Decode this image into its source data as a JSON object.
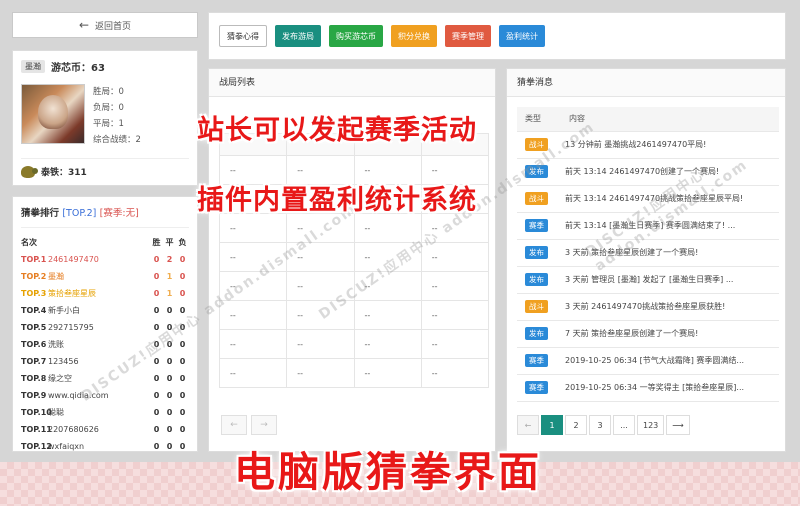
{
  "nav": {
    "back_label": "返回首页"
  },
  "profile": {
    "username_tag": "墨瀚",
    "coins_label": "游芯币：63",
    "stats": [
      "胜局：0",
      "负局：0",
      "平局：1",
      "综合战绩：2"
    ],
    "copper_label": "泰铁：311"
  },
  "ranking": {
    "title": "猜拳排行",
    "top_tag": "[TOP.2]",
    "season_tag": "[赛季:无]",
    "headers": {
      "name": "名次",
      "win": "胜",
      "draw": "平",
      "lose": "负"
    },
    "rows": [
      {
        "pos": "TOP.1",
        "name": "2461497470",
        "w": "0",
        "d": "2",
        "l": "0"
      },
      {
        "pos": "TOP.2",
        "name": "墨瀚",
        "w": "0",
        "d": "1",
        "l": "0"
      },
      {
        "pos": "TOP.3",
        "name": "策拾叁座星辰",
        "w": "0",
        "d": "1",
        "l": "0"
      },
      {
        "pos": "TOP.4",
        "name": "新手小白",
        "w": "0",
        "d": "0",
        "l": "0"
      },
      {
        "pos": "TOP.5",
        "name": "292715795",
        "w": "0",
        "d": "0",
        "l": "0"
      },
      {
        "pos": "TOP.6",
        "name": "洗账",
        "w": "0",
        "d": "0",
        "l": "0"
      },
      {
        "pos": "TOP.7",
        "name": "123456",
        "w": "0",
        "d": "0",
        "l": "0"
      },
      {
        "pos": "TOP.8",
        "name": "缘之空",
        "w": "0",
        "d": "0",
        "l": "0"
      },
      {
        "pos": "TOP.9",
        "name": "www.qidia.com",
        "w": "0",
        "d": "0",
        "l": "0"
      },
      {
        "pos": "TOP.10",
        "name": "聪聪",
        "w": "0",
        "d": "0",
        "l": "0"
      },
      {
        "pos": "TOP.11",
        "name": "2207680626",
        "w": "0",
        "d": "0",
        "l": "0"
      },
      {
        "pos": "TOP.12",
        "name": "wxfaiqxn",
        "w": "0",
        "d": "0",
        "l": "0"
      }
    ]
  },
  "toolbar": {
    "buttons": [
      "猜拳心得",
      "发布游局",
      "购买游芯币",
      "积分兑换",
      "赛季管理",
      "盈利统计"
    ]
  },
  "battle_list": {
    "title": "战局列表",
    "placeholder": "--",
    "pager": [
      "←",
      "→"
    ]
  },
  "messages": {
    "title": "猜拳消息",
    "col_type": "类型",
    "col_content": "内容",
    "rows": [
      {
        "type": "战斗",
        "color": "orange",
        "text": "13 分钟前 墨瀚挑战2461497470平局!"
      },
      {
        "type": "发布",
        "color": "blue",
        "text": "前天 13:14 2461497470创建了一个赛局!"
      },
      {
        "type": "战斗",
        "color": "orange",
        "text": "前天 13:14 2461497470挑战策拾叁座星辰平局!"
      },
      {
        "type": "赛季",
        "color": "blue",
        "text": "前天 13:14 [墨瀚生日赛季] 赛季圆满结束了! ..."
      },
      {
        "type": "发布",
        "color": "blue",
        "text": "3 天前 策拾叁座星辰创建了一个赛局!"
      },
      {
        "type": "发布",
        "color": "blue",
        "text": "3 天前 管理员 [墨瀚] 发起了 [墨瀚生日赛季] ..."
      },
      {
        "type": "战斗",
        "color": "orange",
        "text": "3 天前 2461497470挑战策拾叁座星辰获胜!"
      },
      {
        "type": "发布",
        "color": "blue",
        "text": "7 天前 策拾叁座星辰创建了一个赛局!"
      },
      {
        "type": "赛季",
        "color": "blue",
        "text": "2019-10-25 06:34 [节气大战霜降] 赛季圆满结..."
      },
      {
        "type": "赛季",
        "color": "blue",
        "text": "2019-10-25 06:34 一等奖得主 [策拾叁座星辰]..."
      }
    ],
    "pager": [
      "←",
      "1",
      "2",
      "3",
      "...",
      "123",
      "⟶"
    ]
  },
  "overlay": {
    "line1": "站长可以发起赛季活动",
    "line2": "插件内置盈利统计系统",
    "line3": "电脑版猜拳界面"
  },
  "watermark": "DISCUZ!应用中心 addon.dismall.com"
}
